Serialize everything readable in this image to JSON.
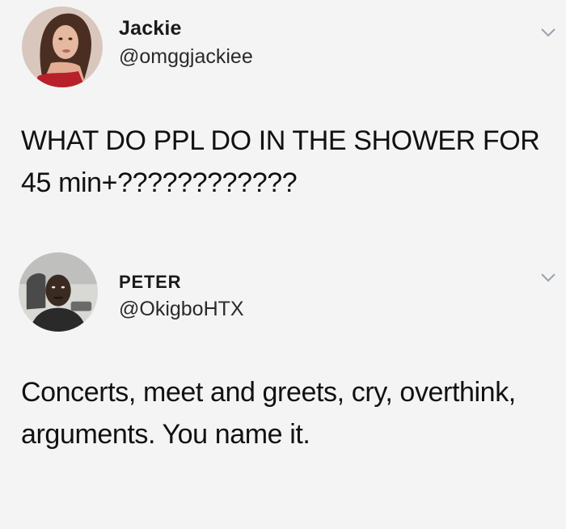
{
  "tweets": [
    {
      "name": "Jackie",
      "handle": "@omggjackiee",
      "text": "WHAT DO PPL DO IN THE SHOWER FOR 45 min+????????????",
      "menu_icon": "chevron-down-icon"
    },
    {
      "name": "PETER",
      "handle": "@OkigboHTX",
      "text": "Concerts, meet and greets, cry, overthink, arguments. You name it.",
      "menu_icon": "chevron-down-icon"
    }
  ],
  "colors": {
    "background": "#f4f4f4",
    "text": "#1a1a1a",
    "chevron": "#9aa3ab"
  }
}
